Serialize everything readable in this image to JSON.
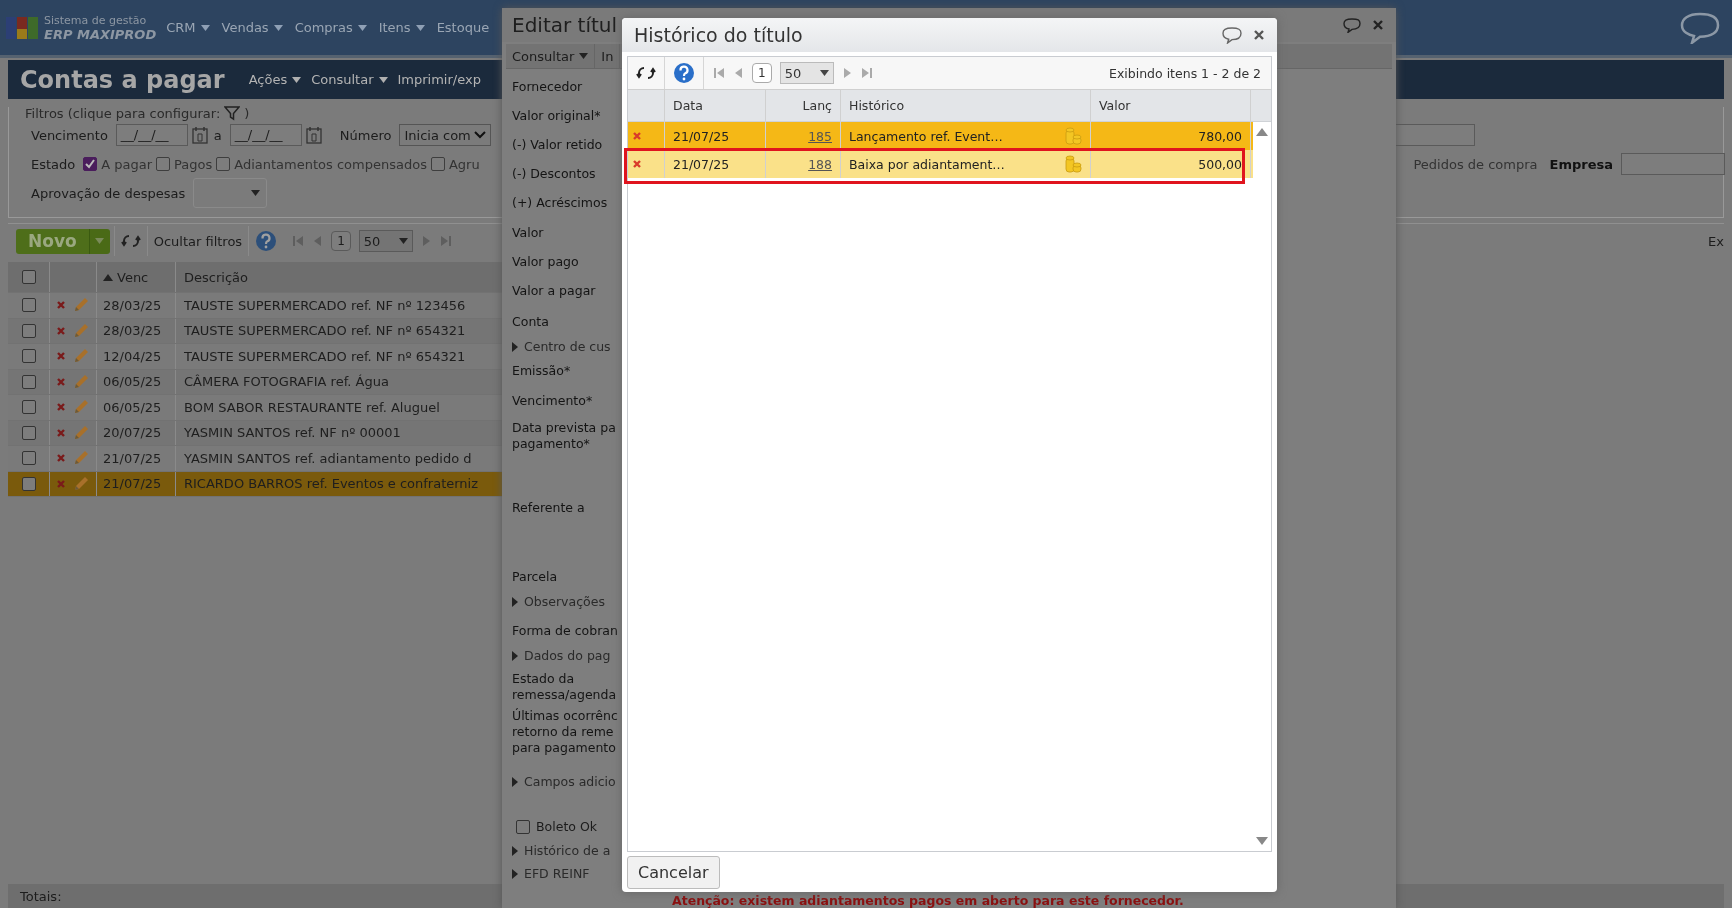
{
  "app": {
    "logo_line1": "Sistema de gestão",
    "logo_line2": "ERP MAXIPROD",
    "menu": [
      {
        "label": "CRM",
        "dropdown": true
      },
      {
        "label": "Vendas",
        "dropdown": true
      },
      {
        "label": "Compras",
        "dropdown": true
      },
      {
        "label": "Itens",
        "dropdown": true
      },
      {
        "label": "Estoque",
        "dropdown": false
      }
    ]
  },
  "page": {
    "title": "Contas a pagar",
    "menu": [
      {
        "label": "Ações",
        "dropdown": true
      },
      {
        "label": "Consultar",
        "dropdown": true
      },
      {
        "label": "Imprimir/exp",
        "dropdown": false
      }
    ]
  },
  "filters": {
    "legend_start": "Filtros (clique para configurar:",
    "legend_end": ")",
    "vencimento_label": "Vencimento",
    "date_from": "__/__/__",
    "between": "a",
    "date_to": "__/__/__",
    "numero_label": "Número",
    "numero_mode": "Inicia com",
    "estado_label": "Estado",
    "estado_options": [
      {
        "label": "A pagar",
        "checked": true
      },
      {
        "label": "Pagos",
        "checked": false
      },
      {
        "label": "Adiantamentos compensados",
        "checked": false
      },
      {
        "label": "Agru",
        "checked": false
      }
    ],
    "pedidos_label": "Pedidos de compra",
    "empresa_label": "Empresa",
    "aprovacao_label": "Aprovação de despesas"
  },
  "toolbar": {
    "new_button": "Novo",
    "hide_filters": "Ocultar filtros",
    "page": "1",
    "page_size": "50",
    "info": "Ex"
  },
  "table": {
    "columns": [
      "Venc",
      "Descrição"
    ],
    "select_all_checked": false,
    "rows": [
      {
        "venc": "28/03/25",
        "descricao": "TAUSTE SUPERMERCADO ref. NF nº 123456",
        "selected": false
      },
      {
        "venc": "28/03/25",
        "descricao": "TAUSTE SUPERMERCADO ref. NF nº 654321",
        "selected": false
      },
      {
        "venc": "12/04/25",
        "descricao": "TAUSTE SUPERMERCADO ref. NF nº 654321",
        "selected": false
      },
      {
        "venc": "06/05/25",
        "descricao": "CÂMERA FOTOGRAFIA ref. Água",
        "selected": false
      },
      {
        "venc": "06/05/25",
        "descricao": "BOM SABOR RESTAURANTE ref. Aluguel",
        "selected": false
      },
      {
        "venc": "20/07/25",
        "descricao": "YASMIN SANTOS ref. NF nº 00001",
        "selected": false
      },
      {
        "venc": "21/07/25",
        "descricao": "YASMIN SANTOS ref. adiantamento pedido d",
        "selected": false
      },
      {
        "venc": "21/07/25",
        "descricao": "RICARDO BARROS ref. Eventos e confraterniz",
        "selected": true
      }
    ],
    "totals_label": "Totais:"
  },
  "edit_window": {
    "title": "Editar títul",
    "menu": [
      {
        "label": "Consultar",
        "dropdown": true
      },
      {
        "label": "In",
        "dropdown": false
      }
    ],
    "fields": [
      {
        "kind": "label",
        "label": "Fornecedor"
      },
      {
        "kind": "label",
        "label": "Valor original*"
      },
      {
        "kind": "label",
        "label": "(-) Valor retido"
      },
      {
        "kind": "label",
        "label": "(-) Descontos"
      },
      {
        "kind": "label",
        "label": "(+) Acréscimos"
      },
      {
        "kind": "label",
        "label": "Valor"
      },
      {
        "kind": "label",
        "label": "Valor pago"
      },
      {
        "kind": "label",
        "label": "Valor a pagar"
      },
      {
        "kind": "label",
        "label": "Conta"
      },
      {
        "kind": "section",
        "label": "Centro de cus"
      },
      {
        "kind": "label",
        "label": "Emissão*"
      },
      {
        "kind": "label",
        "label": "Vencimento*"
      },
      {
        "kind": "label",
        "label": "Data prevista pa\npagamento*"
      },
      {
        "kind": "label",
        "label": "Referente a"
      },
      {
        "kind": "label",
        "label": "Parcela"
      },
      {
        "kind": "section",
        "label": "Observações"
      },
      {
        "kind": "label",
        "label": "Forma de cobran"
      },
      {
        "kind": "section",
        "label": "Dados do pag"
      },
      {
        "kind": "label",
        "label": "Estado da\nremessa/agenda"
      },
      {
        "kind": "label",
        "label": "Últimas ocorrênc\nretorno da reme\npara pagamento"
      },
      {
        "kind": "section",
        "label": "Campos adicio"
      },
      {
        "kind": "checkbox",
        "label": "Boleto Ok",
        "checked": false
      },
      {
        "kind": "section",
        "label": "Histórico de a"
      },
      {
        "kind": "section",
        "label": "EFD REINF"
      }
    ],
    "warning": "Atenção: existem adiantamentos pagos em aberto para este fornecedor."
  },
  "history_dialog": {
    "title": "Histórico do título",
    "page": "1",
    "page_size": "50",
    "info": "Exibindo itens 1 - 2 de 2",
    "columns": [
      "Data",
      "Lanç",
      "Histórico",
      "Valor"
    ],
    "rows": [
      {
        "data": "21/07/25",
        "lanc": "185",
        "historico": "Lançamento ref. Event…",
        "valor": "780,00",
        "selected": true,
        "framed": false
      },
      {
        "data": "21/07/25",
        "lanc": "188",
        "historico": "Baixa por adiantament…",
        "valor": "500,00",
        "selected": false,
        "framed": true
      }
    ],
    "cancel_button": "Cancelar"
  }
}
